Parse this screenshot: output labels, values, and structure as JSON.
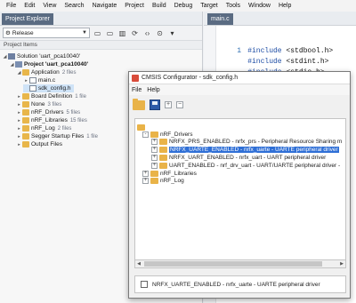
{
  "menubar": {
    "items": [
      "File",
      "Edit",
      "View",
      "Search",
      "Navigate",
      "Project",
      "Build",
      "Debug",
      "Target",
      "Tools",
      "Window",
      "Help"
    ]
  },
  "project_explorer": {
    "tab_label": "Project Explorer",
    "config_select": "Release",
    "section_label": "Project Items",
    "tree": [
      {
        "label": "Solution 'uart_pca10040'",
        "badge": "",
        "icon": "solution-icon"
      },
      {
        "label": "Project 'uart_pca10040'",
        "badge": "",
        "icon": "project-icon"
      },
      {
        "label": "Application",
        "badge": "2 files",
        "icon": "folder-icon"
      },
      {
        "label": "main.c",
        "badge": "",
        "icon": "c-file-icon"
      },
      {
        "label": "sdk_config.h",
        "badge": "",
        "icon": "h-file-icon"
      },
      {
        "label": "Board Definition",
        "badge": "1 file",
        "icon": "folder-icon"
      },
      {
        "label": "None",
        "badge": "3 files",
        "icon": "folder-icon"
      },
      {
        "label": "nRF_Drivers",
        "badge": "5 files",
        "icon": "folder-icon"
      },
      {
        "label": "nRF_Libraries",
        "badge": "15 files",
        "icon": "folder-icon"
      },
      {
        "label": "nRF_Log",
        "badge": "2 files",
        "icon": "folder-icon"
      },
      {
        "label": "Segger Startup Files",
        "badge": "1 file",
        "icon": "folder-icon"
      },
      {
        "label": "Output Files",
        "badge": "",
        "icon": "folder-icon"
      }
    ]
  },
  "editor": {
    "tab_label": "main.c",
    "lines": [
      {
        "num": "1",
        "kw": "#include",
        "text": " <stdbool.h>"
      },
      {
        "num": "",
        "kw": "#include",
        "text": " <stdint.h>"
      },
      {
        "num": "",
        "kw": "#include",
        "text": " <stdio.h>"
      }
    ]
  },
  "dialog": {
    "title": "CMSIS Configurator - sdk_config.h",
    "menu": [
      "File",
      "Help"
    ],
    "tree": [
      {
        "label": "nRF_Drivers",
        "pm": "-",
        "highlight": false
      },
      {
        "label": "NRFX_PRS_ENABLED - nrfx_prs - Peripheral Resource Sharing m",
        "pm": "+",
        "highlight": false
      },
      {
        "label": "NRFX_UARTE_ENABLED - nrfx_uarte - UARTE peripheral driver",
        "pm": "+",
        "highlight": true
      },
      {
        "label": "NRFX_UART_ENABLED - nrfx_uart - UART peripheral driver",
        "pm": "+",
        "highlight": false
      },
      {
        "label": "UART_ENABLED - nrf_drv_uart - UART/UARTE peripheral driver -",
        "pm": "+",
        "highlight": false
      },
      {
        "label": "nRF_Libraries",
        "pm": "+",
        "highlight": false
      },
      {
        "label": "nRF_Log",
        "pm": "+",
        "highlight": false
      }
    ],
    "status_text": "NRFX_UARTE_ENABLED - nrfx_uarte - UARTE peripheral driver"
  },
  "colors": {
    "tab_active": "#5a6b82",
    "selection": "#2f6fd6",
    "folder": "#e9b348"
  }
}
